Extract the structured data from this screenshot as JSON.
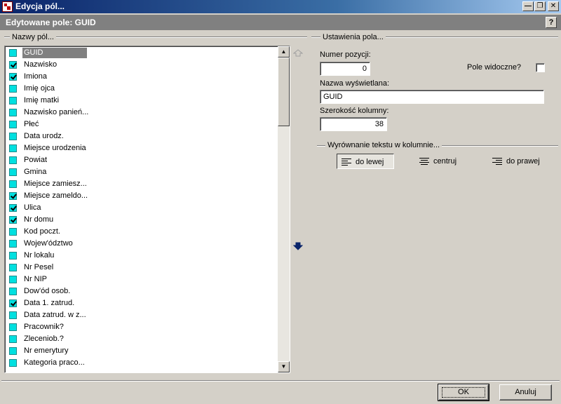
{
  "window": {
    "title": "Edycja pól..."
  },
  "header": {
    "title": "Edytowane pole: GUID",
    "help_label": "?"
  },
  "left_group": {
    "label": "Nazwy pól..."
  },
  "fields": [
    {
      "label": "GUID",
      "checked": false,
      "selected": true
    },
    {
      "label": "Nazwisko",
      "checked": true
    },
    {
      "label": "Imiona",
      "checked": true
    },
    {
      "label": "Imię ojca",
      "checked": false
    },
    {
      "label": "Imię matki",
      "checked": false
    },
    {
      "label": "Nazwisko panień...",
      "checked": false
    },
    {
      "label": "Płeć",
      "checked": false
    },
    {
      "label": "Data urodz.",
      "checked": false
    },
    {
      "label": "Miejsce urodzenia",
      "checked": false
    },
    {
      "label": "Powiat",
      "checked": false
    },
    {
      "label": "Gmina",
      "checked": false
    },
    {
      "label": "Miejsce zamiesz...",
      "checked": false
    },
    {
      "label": "Miejsce zameldo...",
      "checked": true
    },
    {
      "label": "Ulica",
      "checked": true
    },
    {
      "label": "Nr domu",
      "checked": true
    },
    {
      "label": "Kod poczt.",
      "checked": false
    },
    {
      "label": "Wojew'ództwo",
      "checked": false
    },
    {
      "label": "Nr lokalu",
      "checked": false
    },
    {
      "label": "Nr Pesel",
      "checked": false
    },
    {
      "label": "Nr NIP",
      "checked": false
    },
    {
      "label": "Dow'ód osob.",
      "checked": false
    },
    {
      "label": "Data 1. zatrud.",
      "checked": true
    },
    {
      "label": "Data zatrud. w z...",
      "checked": false
    },
    {
      "label": "Pracownik?",
      "checked": false
    },
    {
      "label": "Zleceniob.?",
      "checked": false
    },
    {
      "label": "Nr emerytury",
      "checked": false
    },
    {
      "label": "Kategoria praco...",
      "checked": false
    }
  ],
  "settings": {
    "group_label": "Ustawienia pola...",
    "position": {
      "label": "Numer pozycji:",
      "value": "0"
    },
    "visible": {
      "label": "Pole widoczne?",
      "checked": false
    },
    "display_name": {
      "label": "Nazwa wyświetlana:",
      "value": "GUID"
    },
    "column_width": {
      "label": "Szerokość kolumny:",
      "value": "38"
    }
  },
  "alignment": {
    "group_label": "Wyrównanie tekstu w kolumnie...",
    "left_label": "do lewej",
    "center_label": "centruj",
    "right_label": "do prawej",
    "active": "left"
  },
  "buttons": {
    "ok_label": "OK",
    "cancel_label": "Anuluj"
  },
  "colors": {
    "checkbox_fill": "#00e0e0",
    "title_bar": "#0a246a"
  }
}
